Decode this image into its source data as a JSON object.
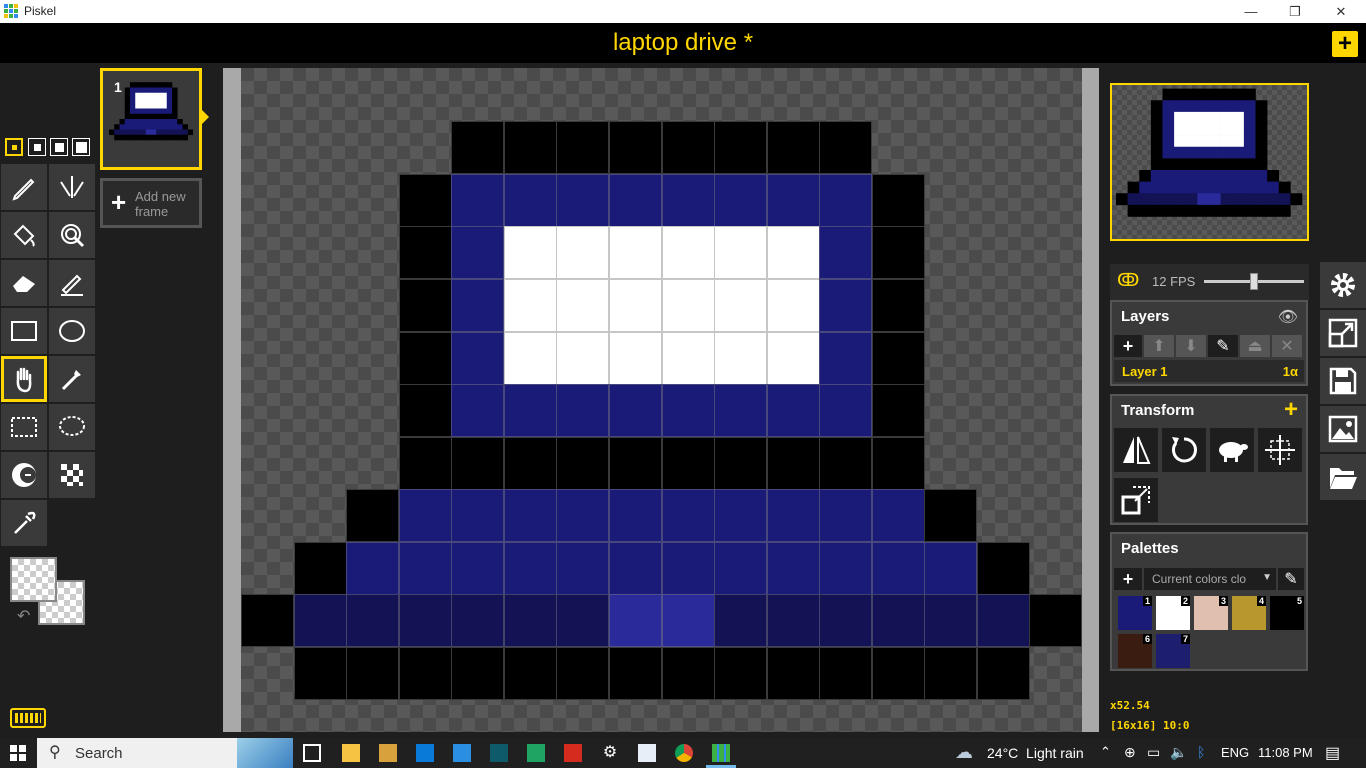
{
  "window": {
    "title": "Piskel",
    "minimize": "—",
    "maximize": "❐",
    "close": "✕"
  },
  "header": {
    "document_title": "laptop drive *",
    "new_button_label": "+"
  },
  "frames": [
    {
      "index": "1"
    }
  ],
  "add_frame": {
    "label_line1": "Add new",
    "label_line2": "frame"
  },
  "tools": [
    {
      "name": "pen-tool",
      "icon": "pen-icon"
    },
    {
      "name": "vertical-mirror-pen-tool",
      "icon": "mirror-pen-icon"
    },
    {
      "name": "paint-bucket-tool",
      "icon": "paint-bucket-icon"
    },
    {
      "name": "paint-all-same-color-tool",
      "icon": "magic-bucket-icon"
    },
    {
      "name": "eraser-tool",
      "icon": "eraser-icon"
    },
    {
      "name": "stroke-tool",
      "icon": "stroke-icon"
    },
    {
      "name": "rectangle-tool",
      "icon": "rectangle-icon"
    },
    {
      "name": "circle-tool",
      "icon": "circle-icon"
    },
    {
      "name": "move-tool",
      "icon": "hand-icon",
      "selected": true
    },
    {
      "name": "shape-selection-tool",
      "icon": "magic-wand-icon"
    },
    {
      "name": "rectangle-selection-tool",
      "icon": "dashed-rectangle-icon"
    },
    {
      "name": "lasso-selection-tool",
      "icon": "lasso-icon"
    },
    {
      "name": "lighten-tool",
      "icon": "lighten-icon"
    },
    {
      "name": "dithering-tool",
      "icon": "checker-icon"
    },
    {
      "name": "color-picker-tool",
      "icon": "eyedropper-icon"
    }
  ],
  "colors": {
    "accent": "#ffd700",
    "panel_bg": "#3a3a3a",
    "app_bg": "#1e1e1e",
    "black": "#000000",
    "navy": "#1a1a78",
    "dark_navy": "#121254",
    "bright_navy": "#2a2a9a",
    "white": "#ffffff"
  },
  "sprite": {
    "size": 16,
    "rows": [
      "................",
      "....KKKKKKKK....",
      "...KBBBBBBBBK...",
      "...KBWWWWWWBK...",
      "...KBWWWWWWBK...",
      "...KBWWWWWWBK...",
      "...KBBBBBBBBK...",
      "...KKKKKKKKKK...",
      "..KBBBBBBBBBBK..",
      ".KBBBBBBBBBBBBK.",
      "KDDDDDDLLDDDDDDK",
      ".KKKKKKKKKKKKKK.",
      "................"
    ]
  },
  "preview": {
    "fps_label": "12 FPS",
    "fps_value": 12,
    "fps_max": 24
  },
  "layers": {
    "title": "Layers",
    "items": [
      {
        "name": "Layer 1",
        "opacity": "1α"
      }
    ]
  },
  "transform": {
    "title": "Transform",
    "add_label": "+"
  },
  "palettes": {
    "title": "Palettes",
    "selected": "Current colors clo",
    "swatches": [
      {
        "index": "1",
        "color": "#1a1a78"
      },
      {
        "index": "2",
        "color": "#ffffff"
      },
      {
        "index": "3",
        "color": "#e0bfae"
      },
      {
        "index": "4",
        "color": "#b8982c"
      },
      {
        "index": "5",
        "color": "#000000"
      },
      {
        "index": "6",
        "color": "#3b1c10"
      },
      {
        "index": "7",
        "color": "#1e1e6e"
      }
    ]
  },
  "status": {
    "zoom": "x52.54",
    "size_and_cursor": "[16x16] 10:0"
  },
  "taskbar": {
    "search_placeholder": "Search",
    "weather": "24°C  Light rain",
    "language": "ENG",
    "time": "11:08 PM"
  }
}
